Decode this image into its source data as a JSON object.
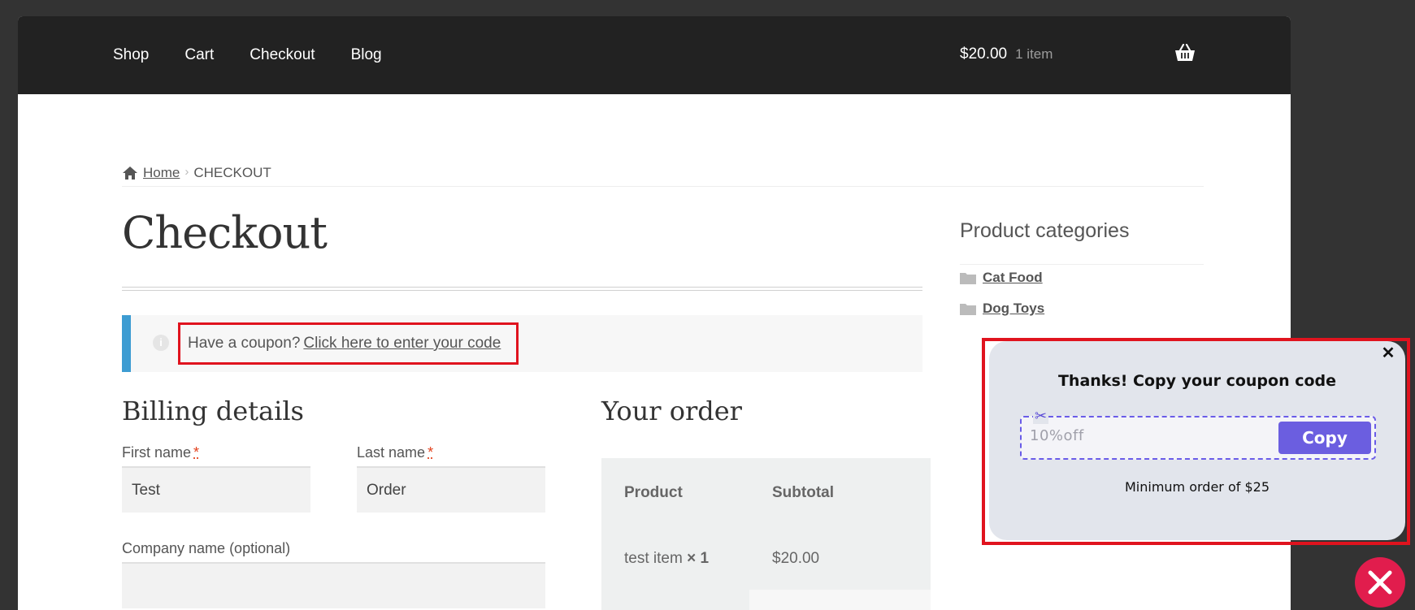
{
  "nav": {
    "items": [
      {
        "label": "Shop",
        "current": false
      },
      {
        "label": "Cart",
        "current": false
      },
      {
        "label": "Checkout",
        "current": true
      },
      {
        "label": "Blog",
        "current": false
      }
    ],
    "cart_total": "$20.00",
    "cart_count": "1 item",
    "cart_icon": "basket-icon"
  },
  "breadcrumb": {
    "home_label": "Home",
    "current": "CHECKOUT"
  },
  "page_title": "Checkout",
  "coupon_notice": {
    "prompt": "Have a coupon?",
    "link": "Click here to enter your code"
  },
  "sidebar": {
    "heading": "Product categories",
    "categories": [
      "Cat Food",
      "Dog Toys"
    ]
  },
  "billing": {
    "heading": "Billing details",
    "first_name_label": "First name",
    "first_name_value": "Test",
    "last_name_label": "Last name",
    "last_name_value": "Order",
    "company_label": "Company name (optional)",
    "required_marker": "*"
  },
  "order": {
    "heading": "Your order",
    "col_product": "Product",
    "col_subtotal": "Subtotal",
    "item_name": "test item",
    "item_qty": "× 1",
    "item_subtotal": "$20.00"
  },
  "popup": {
    "title": "Thanks! Copy your coupon code",
    "code": "10%off",
    "copy_label": "Copy",
    "min_order": "Minimum order of $25",
    "close_glyph": "✕",
    "scissors_glyph": "✂"
  },
  "colors": {
    "topbar": "#222222",
    "notice_accent": "#3d9cd2",
    "highlight_border": "#e0131e",
    "copy_button": "#6b5ee0",
    "dismiss_button": "#e11d4d"
  }
}
